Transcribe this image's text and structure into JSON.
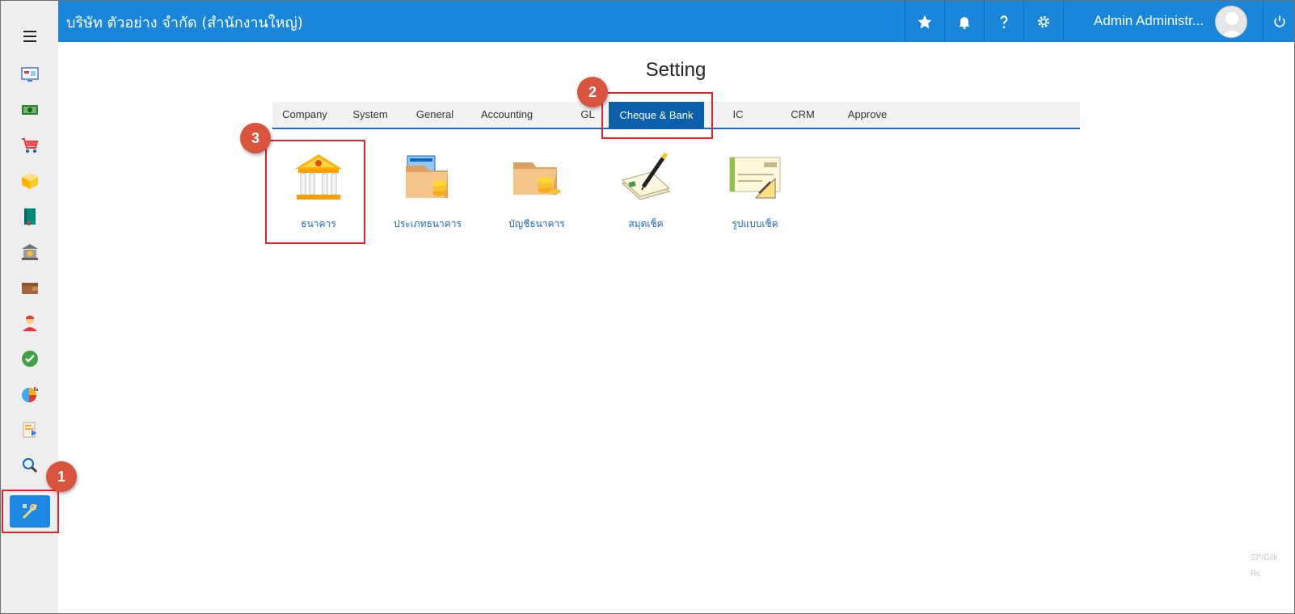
{
  "header": {
    "company": "บริษัท ตัวอย่าง จำกัด (สำนักงานใหญ่)",
    "user": "Admin Administr...",
    "icons": [
      "star-icon",
      "bell-icon",
      "help-icon",
      "gear-icon",
      "power-icon"
    ]
  },
  "sidebar": {
    "items": [
      "dashboard-icon",
      "money-icon",
      "cart-icon",
      "box-icon",
      "book-icon",
      "bank-icon",
      "wallet-icon",
      "person-icon",
      "check-icon",
      "pie-chart-icon",
      "report-icon",
      "search-icon",
      "tools-icon"
    ],
    "active": "tools-icon"
  },
  "page": {
    "title": "Setting"
  },
  "tabs": [
    {
      "label": "Company"
    },
    {
      "label": "System"
    },
    {
      "label": "General"
    },
    {
      "label": "Accounting"
    },
    {
      "label": "GL"
    },
    {
      "label": "Cheque & Bank"
    },
    {
      "label": "IC"
    },
    {
      "label": "CRM"
    },
    {
      "label": "Approve"
    }
  ],
  "active_tab": "Cheque & Bank",
  "tiles": [
    {
      "label": "ธนาคาร",
      "icon": "bank-building-icon"
    },
    {
      "label": "ประเภทธนาคาร",
      "icon": "folder-coins-icon"
    },
    {
      "label": "บัญชีธนาคาร",
      "icon": "folder-coins-icon"
    },
    {
      "label": "สมุดเช็ค",
      "icon": "cheque-pen-icon"
    },
    {
      "label": "รูปแบบเช็ค",
      "icon": "cheque-template-icon"
    }
  ],
  "annotations": [
    "1",
    "2",
    "3"
  ],
  "ghost_text": [
    "SP/Gilk",
    "Rc"
  ],
  "colors": {
    "topbar": "#1a86d9",
    "active_tab": "#0b5fab",
    "annotation_badge": "#d9533d",
    "annotation_box": "#e0242b",
    "tile_label": "#1a6bbf"
  }
}
